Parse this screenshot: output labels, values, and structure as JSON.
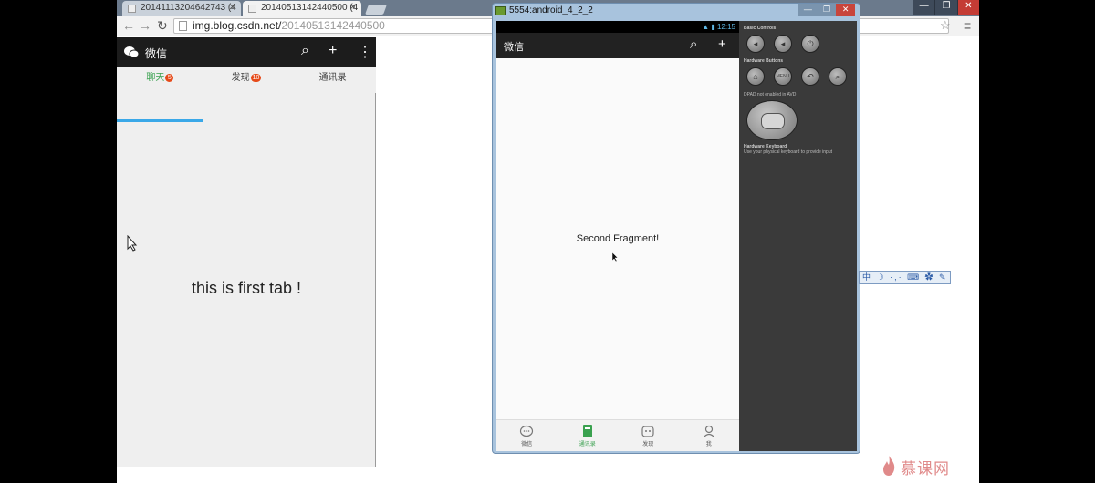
{
  "browser": {
    "tabs": [
      {
        "label": "20141113204642743 (4",
        "active": false
      },
      {
        "label": "20140513142440500 (4",
        "active": true
      }
    ],
    "url_host": "img.blog.csdn.net/",
    "url_path": "20140513142440500",
    "window_controls": [
      "—",
      "❐",
      "✕"
    ]
  },
  "webapp": {
    "title": "微信",
    "tabs": [
      {
        "label": "聊天",
        "badge": "5",
        "active": true
      },
      {
        "label": "发现",
        "badge": "10",
        "active": false
      },
      {
        "label": "通讯录",
        "badge": "",
        "active": false
      }
    ],
    "content_text": "this is first tab !"
  },
  "emulator": {
    "window_title": "5554:android_4_2_2",
    "window_controls": [
      "—",
      "❐",
      "✕"
    ],
    "status_time": "12:15",
    "app_title": "微信",
    "fragment_text": "Second Fragment!",
    "bottom_nav": [
      {
        "label": "微信",
        "active": false
      },
      {
        "label": "通讯录",
        "active": true
      },
      {
        "label": "发现",
        "active": false
      },
      {
        "label": "我",
        "active": false
      }
    ],
    "controls": {
      "basic_header": "Basic Controls",
      "hardware_header": "Hardware Buttons",
      "menu_label": "MENU",
      "dpad_note": "DPAD not enabled in AVD",
      "keyboard_header": "Hardware Keyboard",
      "keyboard_note": "Use your physical keyboard to provide input"
    }
  },
  "ime": {
    "text": "中 ☽ ·,· ⌨ ✿ ✎"
  },
  "watermark": {
    "text": "慕课网"
  },
  "colors": {
    "accent_green": "#3aa14f",
    "accent_blue": "#3aa8e8",
    "badge_red": "#e64a19"
  }
}
